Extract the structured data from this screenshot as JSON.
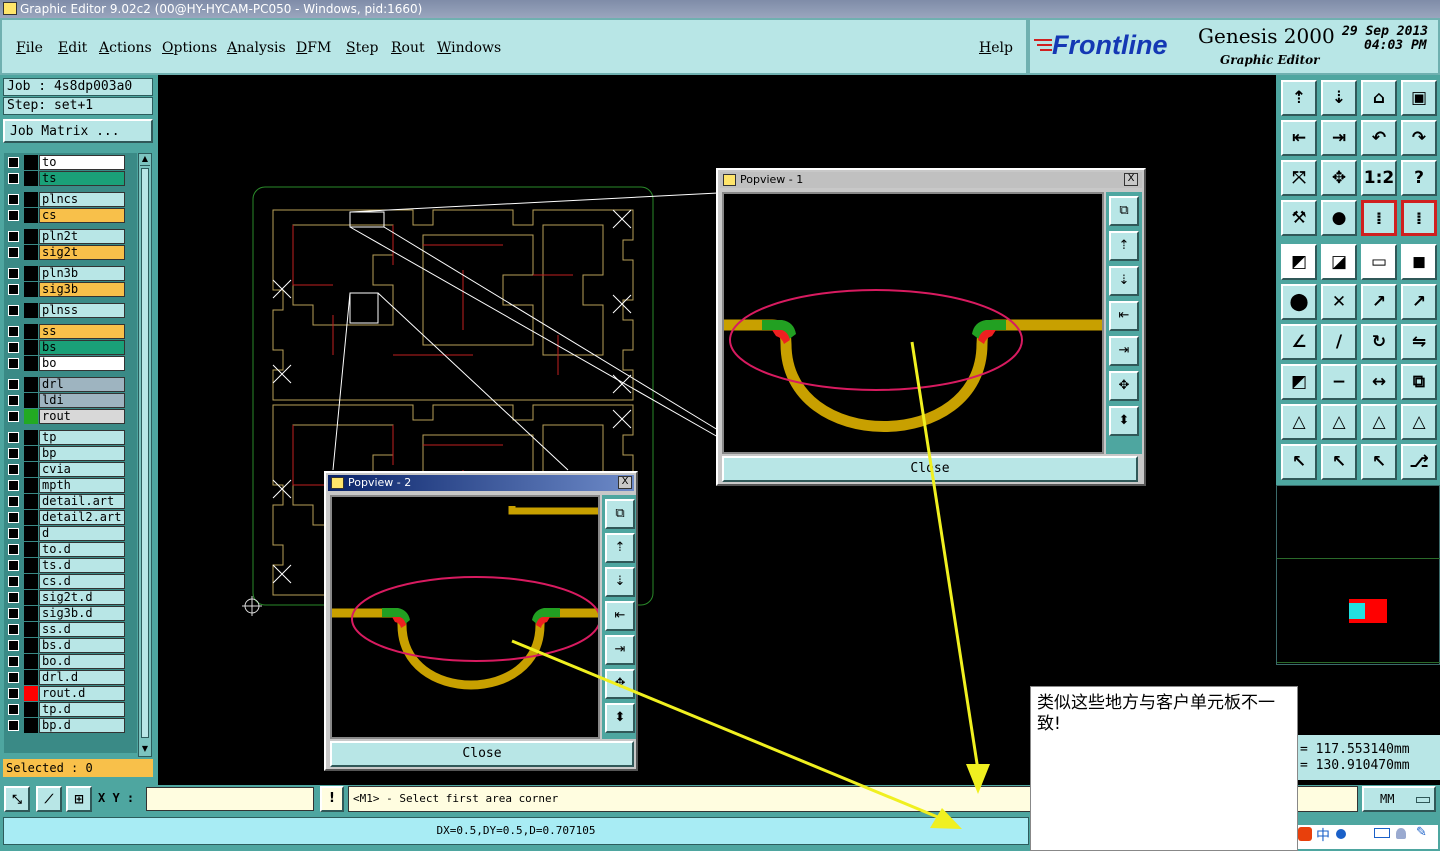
{
  "window": {
    "title": "Graphic Editor 9.02c2 (00@HY-HYCAM-PC050 - Windows, pid:1660)"
  },
  "menu": {
    "file": "File",
    "edit": "Edit",
    "actions": "Actions",
    "options": "Options",
    "analysis": "Analysis",
    "dfm": "DFM",
    "step": "Step",
    "rout": "Rout",
    "windows": "Windows",
    "help": "Help"
  },
  "brand": {
    "logo": "Frontline",
    "product": "Genesis 2000",
    "subtitle": "Graphic Editor",
    "date": "29 Sep 2013",
    "time": "04:03 PM"
  },
  "job": {
    "job_line": "Job : 4s8dp003a0",
    "step_line": "Step: set+1",
    "matrix_button": "Job Matrix ..."
  },
  "layers": [
    {
      "name": "to",
      "color": "#ffffff",
      "swatch": "#000000"
    },
    {
      "name": "ts",
      "color": "#1aa078",
      "swatch": "#000000"
    },
    {
      "name": "plncs",
      "color": "#b8e6e6",
      "swatch": "#000000"
    },
    {
      "name": "cs",
      "color": "#f8c04a",
      "swatch": "#000000"
    },
    {
      "name": "pln2t",
      "color": "#b8e6e6",
      "swatch": "#000000"
    },
    {
      "name": "sig2t",
      "color": "#f8c04a",
      "swatch": "#000000"
    },
    {
      "name": "pln3b",
      "color": "#b8e6e6",
      "swatch": "#000000"
    },
    {
      "name": "sig3b",
      "color": "#f8c04a",
      "swatch": "#000000"
    },
    {
      "name": "plnss",
      "color": "#b8e6e6",
      "swatch": "#000000"
    },
    {
      "name": "ss",
      "color": "#f8c04a",
      "swatch": "#000000"
    },
    {
      "name": "bs",
      "color": "#1aa078",
      "swatch": "#000000"
    },
    {
      "name": "bo",
      "color": "#ffffff",
      "swatch": "#000000"
    },
    {
      "name": "drl",
      "color": "#9eb4c0",
      "swatch": "#000000"
    },
    {
      "name": "ldi",
      "color": "#9eb4c0",
      "swatch": "#000000"
    },
    {
      "name": "rout",
      "color": "#d8d8d8",
      "swatch": "#22aa22"
    },
    {
      "name": "tp",
      "color": "#b8e6e6",
      "swatch": "#000000"
    },
    {
      "name": "bp",
      "color": "#b8e6e6",
      "swatch": "#000000"
    },
    {
      "name": "cvia",
      "color": "#b8e6e6",
      "swatch": "#000000"
    },
    {
      "name": "mpth",
      "color": "#b8e6e6",
      "swatch": "#000000"
    },
    {
      "name": "detail.art",
      "color": "#b8e6e6",
      "swatch": "#000000"
    },
    {
      "name": "detail2.art",
      "color": "#b8e6e6",
      "swatch": "#000000"
    },
    {
      "name": "d",
      "color": "#b8e6e6",
      "swatch": "#000000"
    },
    {
      "name": "to.d",
      "color": "#b8e6e6",
      "swatch": "#000000"
    },
    {
      "name": "ts.d",
      "color": "#b8e6e6",
      "swatch": "#000000"
    },
    {
      "name": "cs.d",
      "color": "#b8e6e6",
      "swatch": "#000000"
    },
    {
      "name": "sig2t.d",
      "color": "#b8e6e6",
      "swatch": "#000000"
    },
    {
      "name": "sig3b.d",
      "color": "#b8e6e6",
      "swatch": "#000000"
    },
    {
      "name": "ss.d",
      "color": "#b8e6e6",
      "swatch": "#000000"
    },
    {
      "name": "bs.d",
      "color": "#b8e6e6",
      "swatch": "#000000"
    },
    {
      "name": "bo.d",
      "color": "#b8e6e6",
      "swatch": "#000000"
    },
    {
      "name": "drl.d",
      "color": "#b8e6e6",
      "swatch": "#000000"
    },
    {
      "name": "rout.d",
      "color": "#b8e6e6",
      "swatch": "#ff0000"
    },
    {
      "name": "tp.d",
      "color": "#b8e6e6",
      "swatch": "#000000"
    },
    {
      "name": "bp.d",
      "color": "#b8e6e6",
      "swatch": "#000000"
    }
  ],
  "selected": "Selected : 0",
  "popview1": {
    "title": "Popview - 1",
    "close": "Close",
    "close_x": "X"
  },
  "popview2": {
    "title": "Popview - 2",
    "close": "Close",
    "close_x": "X"
  },
  "toolbar_icons": [
    "zoom-home",
    "zoom-in",
    "zoom-out",
    "zoom-fit",
    "pan-left",
    "pan-right",
    "undo-view",
    "redo-view",
    "fit-screen",
    "center",
    "one-to-one",
    "help",
    "measure",
    "snap",
    "layer-sel",
    "layer-sel2",
    "feature",
    "mark",
    "ruler",
    "pad",
    "connect",
    "delete",
    "move",
    "copy",
    "angle",
    "line",
    "rotate",
    "flip",
    "attr-a",
    "attr-b",
    "measure-box",
    "group",
    "triangle-a",
    "triangle-b",
    "triangle-c",
    "triangle-d",
    "select",
    "select-box",
    "select-arrow",
    "route"
  ],
  "coords": {
    "x": "= 117.553140mm",
    "y": "= 130.910470mm"
  },
  "bottom": {
    "xy_label": "X Y :",
    "xy_value": "",
    "prompt": "<M1> - Select first area corner",
    "units": "MM"
  },
  "status": {
    "text": "DX=0.5,DY=0.5,D=0.707105"
  },
  "note": {
    "text": "类似这些地方与客户单元板不一致!"
  },
  "ime": {
    "label": "中"
  },
  "colors": {
    "panel": "#b8e6e6",
    "teal": "#4ea6a0",
    "orange": "#f8c04a",
    "highlight": "#d81b60",
    "arrow": "#f0f020"
  }
}
